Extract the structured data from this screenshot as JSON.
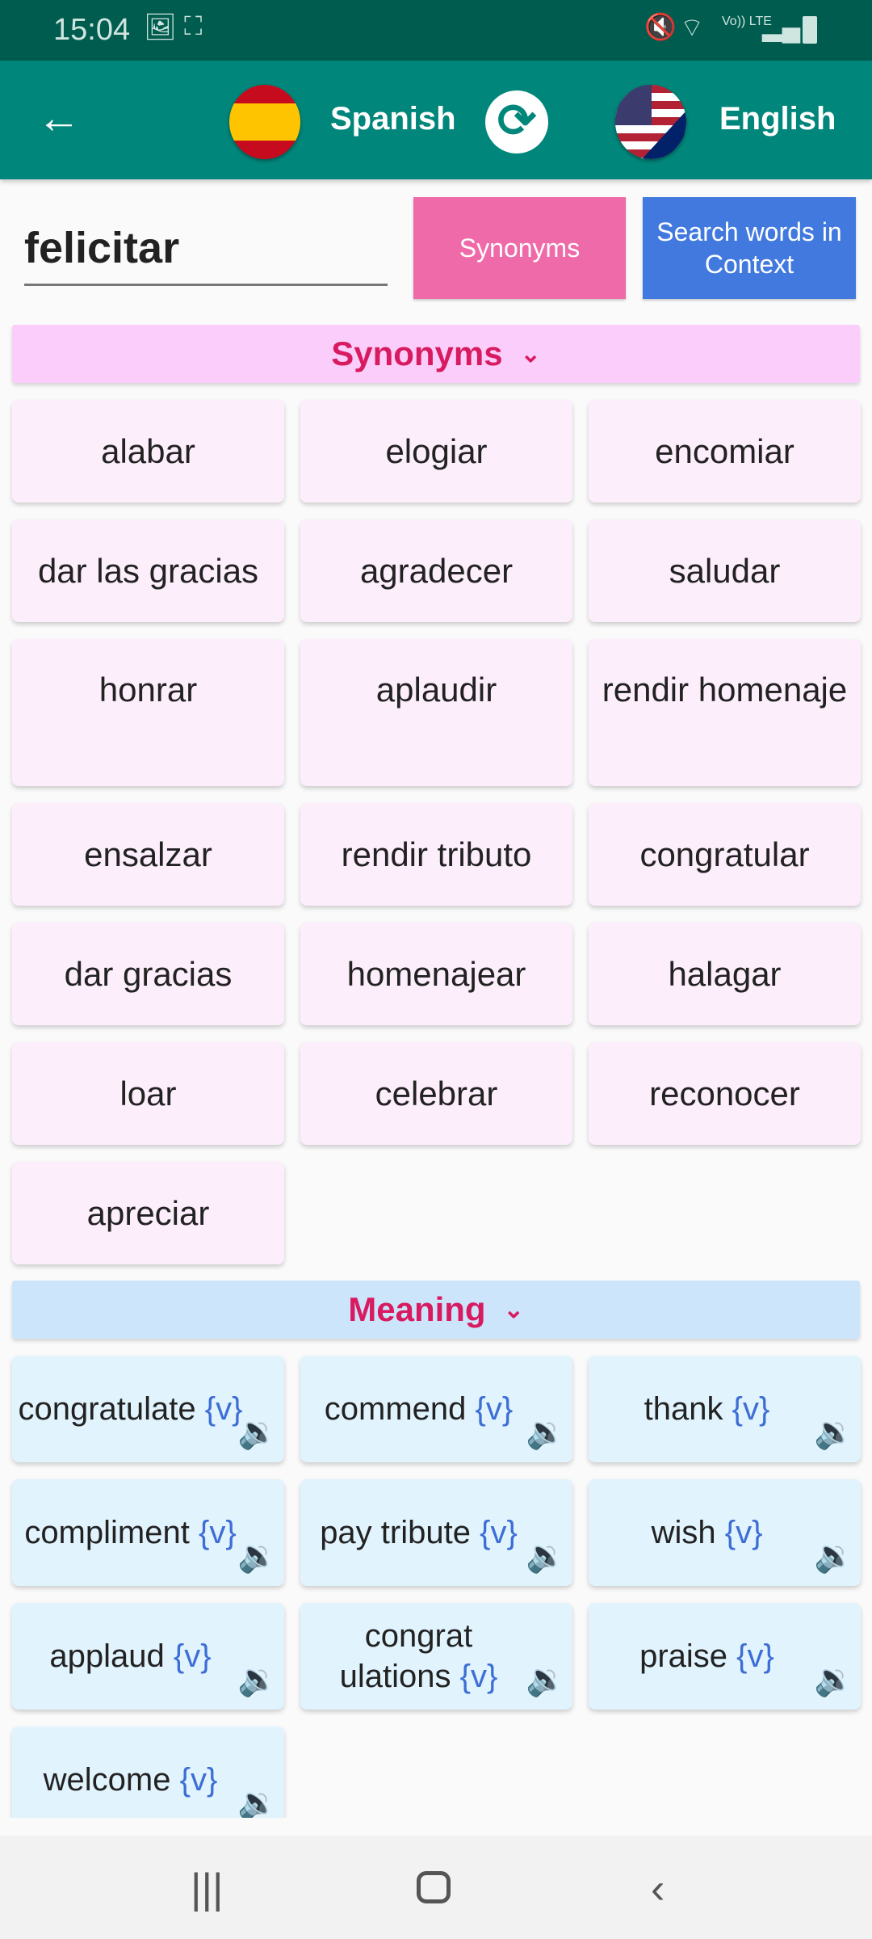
{
  "status": {
    "time": "15:04",
    "icons": [
      "image-icon",
      "screen-record-icon",
      "mute-icon",
      "wifi-icon",
      "volte-icon",
      "signal-icon",
      "battery-icon"
    ],
    "volte": "Vo)) LTE"
  },
  "toolbar": {
    "source_lang": "Spanish",
    "target_lang": "English",
    "icons": [
      "back-arrow-icon",
      "spain-flag-icon",
      "swap-icon",
      "us-uk-flag-icon"
    ]
  },
  "search": {
    "value": "felicitar",
    "synonyms_button": "Synonyms",
    "context_button": "Search words in Context"
  },
  "synonyms": {
    "header": "Synonyms",
    "items": [
      "alabar",
      "elogiar",
      "encomiar",
      "dar las gracias",
      "agradecer",
      "saludar",
      "honrar",
      "aplaudir",
      "rendir homenaje",
      "ensalzar",
      "rendir tributo",
      "congratular",
      "dar gracias",
      "homenajear",
      "halagar",
      "loar",
      "celebrar",
      "reconocer",
      "apreciar"
    ]
  },
  "meaning": {
    "header": "Meaning",
    "pos": "{v}",
    "items": [
      "congratulate",
      "commend",
      "thank",
      "compliment",
      "pay tribute",
      "wish",
      "applaud",
      "congrat ulations",
      "praise",
      "welcome"
    ]
  },
  "colors": {
    "status_bar": "#005c4f",
    "toolbar": "#00867a",
    "synonyms_button": "#ef6aa8",
    "context_button": "#4179de",
    "header_text": "#d81b60",
    "synonyms_header_bg": "#fbcdfb",
    "meaning_header_bg": "#cce5fb"
  }
}
